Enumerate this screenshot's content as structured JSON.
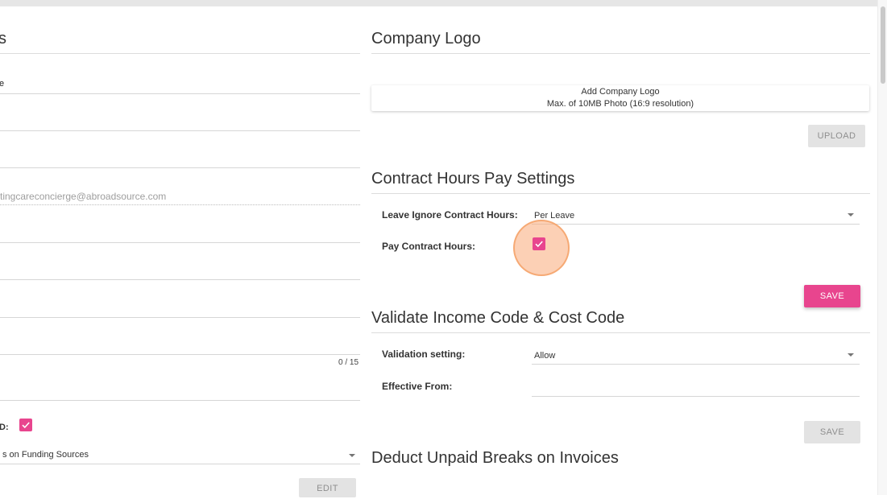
{
  "left_panel": {
    "heading_fragment": "s",
    "field1_label_fragment": "e",
    "email_fragment": "tingcareconcierge@abroadsource.com",
    "counter": "0 / 15",
    "checkbox_label_fragment": "D:",
    "funding_select_value": "s on Funding Sources",
    "edit_label": "EDIT"
  },
  "company_logo": {
    "title": "Company Logo",
    "add_text": "Add Company Logo",
    "max_text": "Max. of 10MB Photo (16:9 resolution)",
    "upload_label": "UPLOAD"
  },
  "contract_hours": {
    "title": "Contract Hours Pay Settings",
    "leave_ignore_label": "Leave Ignore Contract Hours:",
    "leave_ignore_value": "Per Leave",
    "pay_contract_label": "Pay Contract Hours:",
    "pay_contract_checked": true,
    "save_label": "SAVE"
  },
  "validate_codes": {
    "title": "Validate Income Code & Cost Code",
    "validation_label": "Validation setting:",
    "validation_value": "Allow",
    "effective_label": "Effective From:",
    "effective_value": "",
    "save_label": "SAVE"
  },
  "deduct_breaks": {
    "title": "Deduct Unpaid Breaks on Invoices"
  },
  "colors": {
    "accent": "#e8458e",
    "disabled_button": "#e3e3e3",
    "click_highlight": "#f5a064"
  },
  "icons": {
    "checkmark": "check-icon",
    "dropdown": "chevron-down-icon"
  }
}
